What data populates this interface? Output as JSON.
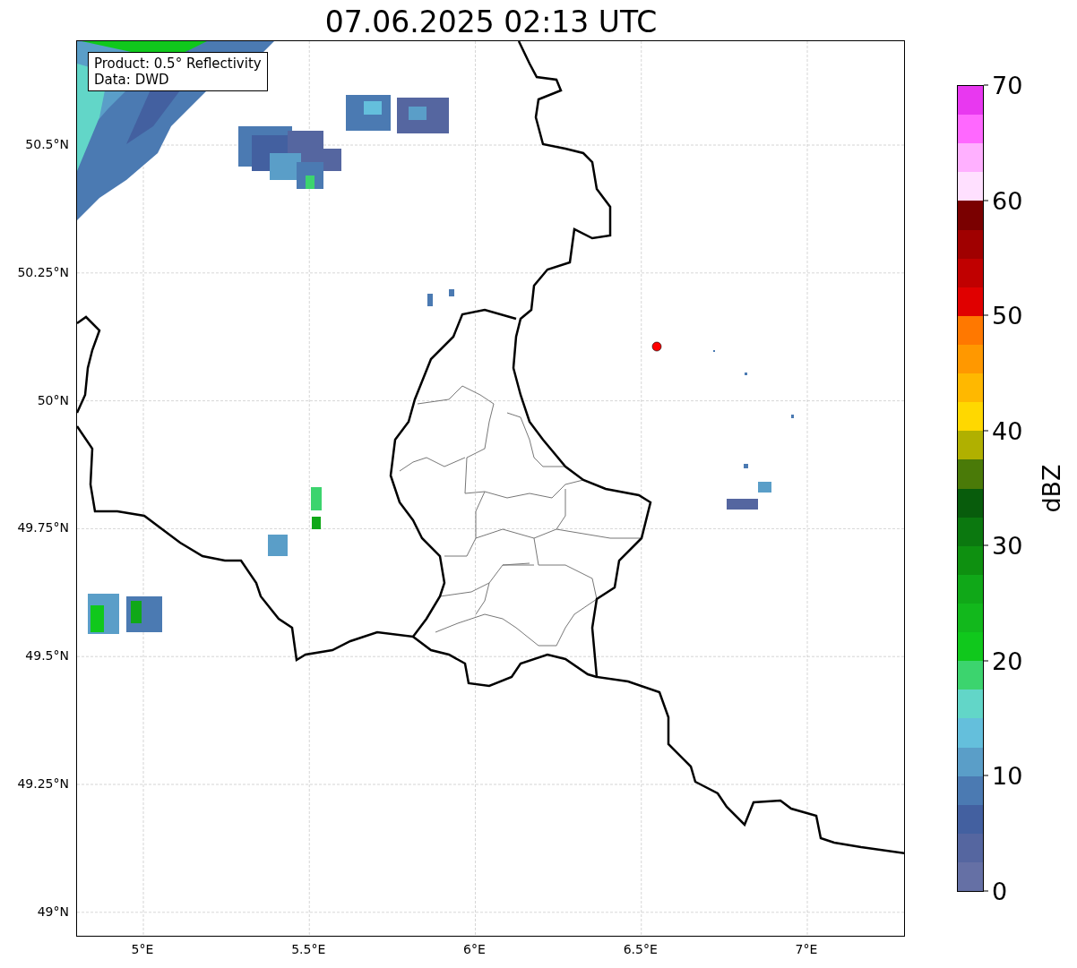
{
  "title": "07.06.2025 02:13 UTC",
  "info_box": {
    "lines": [
      "Product: 0.5° Reflectivity",
      "Data: DWD"
    ]
  },
  "map": {
    "lat_ticks": [
      "50.5°N",
      "50.25°N",
      "50°N",
      "49.75°N",
      "49.5°N",
      "49.25°N",
      "49°N"
    ],
    "lon_ticks": [
      "5°E",
      "5.5°E",
      "6°E",
      "6.5°E",
      "7°E"
    ]
  },
  "colorbar": {
    "label": "dBZ",
    "ticks": [
      "70",
      "60",
      "50",
      "40",
      "30",
      "20",
      "10",
      "0"
    ],
    "bins": [
      {
        "color": "#e838f0"
      },
      {
        "color": "#ff68ff"
      },
      {
        "color": "#ffb0ff"
      },
      {
        "color": "#ffe0ff"
      },
      {
        "color": "#7a0000"
      },
      {
        "color": "#a00000"
      },
      {
        "color": "#c00000"
      },
      {
        "color": "#e00000"
      },
      {
        "color": "#ff7800"
      },
      {
        "color": "#ff9800"
      },
      {
        "color": "#ffb800"
      },
      {
        "color": "#ffd800"
      },
      {
        "color": "#b0b000"
      },
      {
        "color": "#4a7a08"
      },
      {
        "color": "#085c0c"
      },
      {
        "color": "#0b780f"
      },
      {
        "color": "#0e9010"
      },
      {
        "color": "#10a818"
      },
      {
        "color": "#12b81c"
      },
      {
        "color": "#10c81c"
      },
      {
        "color": "#3cd46e"
      },
      {
        "color": "#62d6c8"
      },
      {
        "color": "#64bfdc"
      },
      {
        "color": "#5a9ec8"
      },
      {
        "color": "#4b7ab2"
      },
      {
        "color": "#4360a0"
      },
      {
        "color": "#5566a0"
      },
      {
        "color": "#6570a5"
      }
    ]
  }
}
